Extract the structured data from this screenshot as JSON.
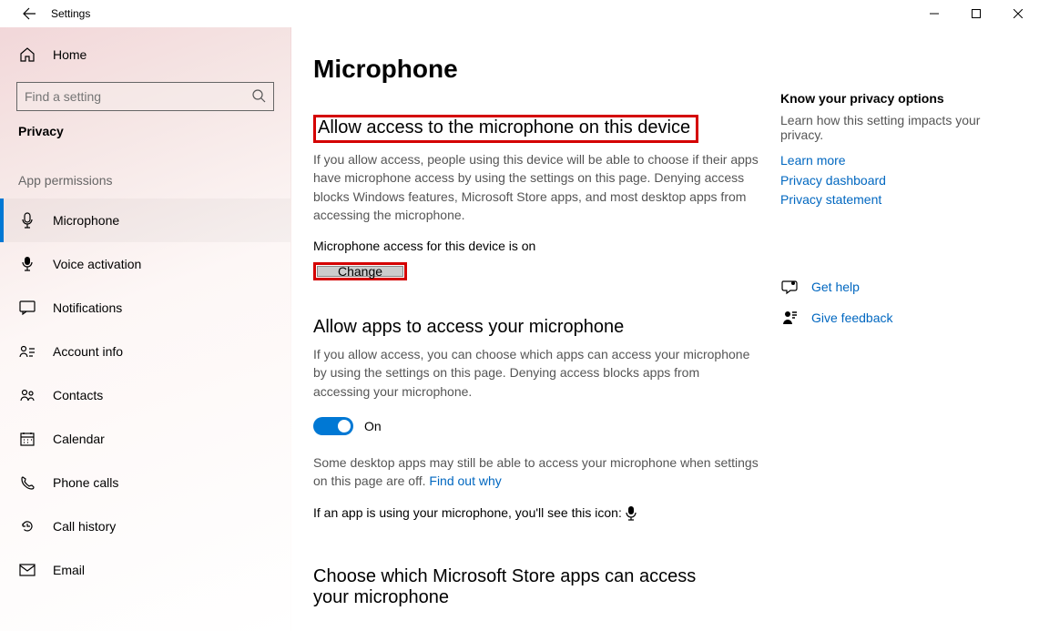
{
  "window": {
    "title": "Settings"
  },
  "sidebar": {
    "home": "Home",
    "search_placeholder": "Find a setting",
    "category": "Privacy",
    "group_label": "App permissions",
    "items": [
      {
        "label": "Microphone",
        "selected": true
      },
      {
        "label": "Voice activation"
      },
      {
        "label": "Notifications"
      },
      {
        "label": "Account info"
      },
      {
        "label": "Contacts"
      },
      {
        "label": "Calendar"
      },
      {
        "label": "Phone calls"
      },
      {
        "label": "Call history"
      },
      {
        "label": "Email"
      }
    ]
  },
  "main": {
    "page_title": "Microphone",
    "section1": {
      "heading": "Allow access to the microphone on this device",
      "description": "If you allow access, people using this device will be able to choose if their apps have microphone access by using the settings on this page. Denying access blocks Windows features, Microsoft Store apps, and most desktop apps from accessing the microphone.",
      "status": "Microphone access for this device is on",
      "change_button": "Change"
    },
    "section2": {
      "heading": "Allow apps to access your microphone",
      "description": "If you allow access, you can choose which apps can access your microphone by using the settings on this page. Denying access blocks apps from accessing your microphone.",
      "toggle_state": "On",
      "note_part1": "Some desktop apps may still be able to access your microphone when settings on this page are off. ",
      "note_link": "Find out why",
      "usage_line": "If an app is using your microphone, you'll see this icon:"
    },
    "section3": {
      "heading": "Choose which Microsoft Store apps can access your microphone"
    }
  },
  "rightcol": {
    "heading": "Know your privacy options",
    "description": "Learn how this setting impacts your privacy.",
    "links": [
      "Learn more",
      "Privacy dashboard",
      "Privacy statement"
    ],
    "help": "Get help",
    "feedback": "Give feedback"
  }
}
